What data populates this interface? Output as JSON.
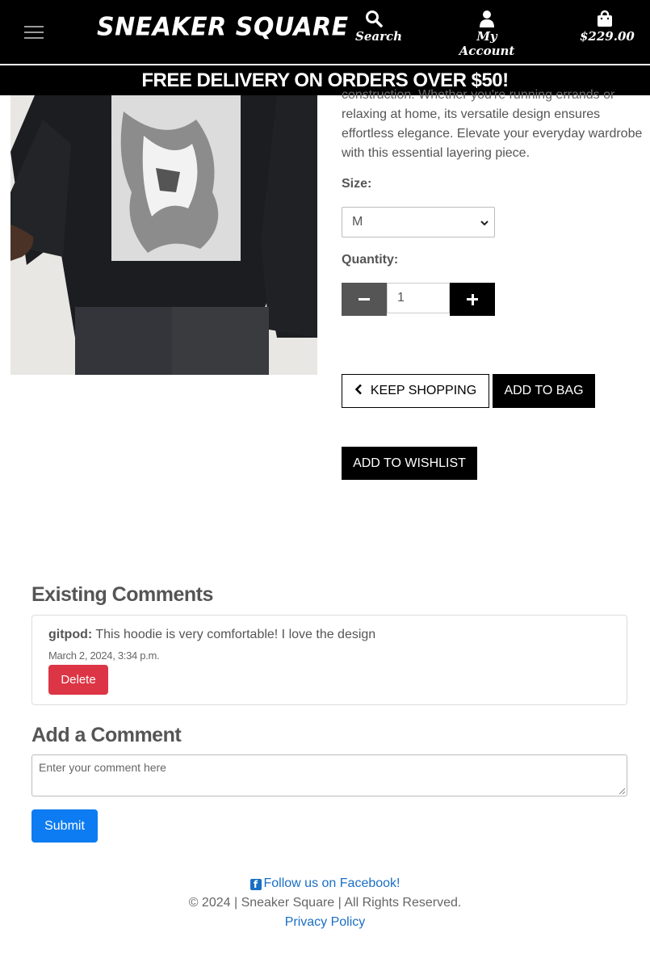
{
  "header": {
    "brand": "SNEAKER SQUARE",
    "search_label": "Search",
    "account_label": "My Account",
    "bag_total": "$229.00"
  },
  "promo": {
    "text": "FREE DELIVERY ON ORDERS OVER $50!"
  },
  "product": {
    "description_partial_line": "construction. Whether you're running errands or",
    "description": "relaxing at home, its versatile design ensures effortless elegance. Elevate your everyday wardrobe with this essential layering piece.",
    "size_label": "Size:",
    "size_value": "M",
    "quantity_label": "Quantity:",
    "quantity_value": "1",
    "keep_shopping": "KEEP SHOPPING",
    "add_to_bag": "ADD TO BAG",
    "add_to_wishlist": "ADD TO WISHLIST"
  },
  "comments": {
    "heading": "Existing Comments",
    "items": [
      {
        "user": "gitpod:",
        "text": "This hoodie is very comfortable! I love the design",
        "date": "March 2, 2024, 3:34 p.m.",
        "delete_label": "Delete"
      }
    ]
  },
  "add_comment": {
    "heading": "Add a Comment",
    "placeholder": "Enter your comment here",
    "submit_label": "Submit"
  },
  "footer": {
    "facebook": "Follow us on Facebook!",
    "copyright": "© 2024 | Sneaker Square | All Rights Reserved.",
    "privacy": "Privacy Policy"
  },
  "icons": {
    "menu": "hamburger-icon",
    "search": "search-icon",
    "account": "user-icon",
    "bag": "shopping-bag-icon",
    "back": "chevron-left-icon",
    "facebook": "facebook-icon"
  },
  "colors": {
    "header_bg": "#000000",
    "delete": "#dc3545",
    "submit": "#0d7cf2",
    "link": "#1a6fc4"
  }
}
